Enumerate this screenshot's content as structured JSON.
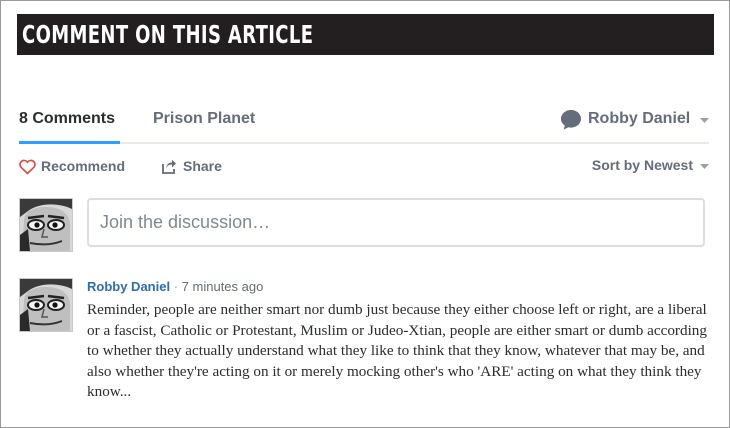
{
  "banner": {
    "title": "COMMENT ON THIS ARTICLE"
  },
  "tabs": {
    "count_label": "8 Comments",
    "forum_label": "Prison Planet"
  },
  "user": {
    "name": "Robby Daniel",
    "icon": "speech-bubble-icon"
  },
  "actions": {
    "recommend_label": "Recommend",
    "share_label": "Share",
    "sort_label": "Sort by Newest"
  },
  "composer": {
    "placeholder": "Join the discussion…"
  },
  "comment": {
    "author": "Robby Daniel",
    "separator": "·",
    "time": "7 minutes ago",
    "body": "Reminder, people are neither smart nor dumb just because they either choose left or right, are a liberal or a fascist, Catholic or Protestant, Muslim or Judeo-Xtian, people are either smart or dumb according to whether they actually understand what they like to think that they know, whatever that may be, and also whether they're acting on it or merely mocking other's who 'ARE' acting on what they think they know..."
  },
  "colors": {
    "banner_bg": "#231f20",
    "accent_blue": "#2e9fff",
    "author_link": "#2e6db0",
    "heart": "#e0443f"
  }
}
